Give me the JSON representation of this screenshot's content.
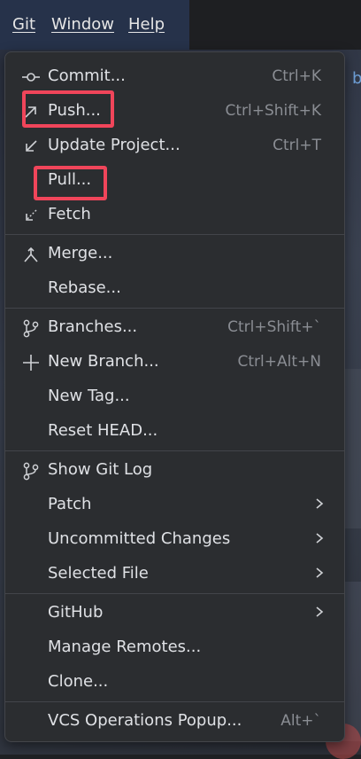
{
  "menubar": {
    "git": "Git",
    "window": "Window",
    "help": "Help"
  },
  "edge_text": "b",
  "menu": {
    "commit": {
      "label": "Commit...",
      "shortcut": "Ctrl+K"
    },
    "push": {
      "label": "Push...",
      "shortcut": "Ctrl+Shift+K"
    },
    "update_project": {
      "label": "Update Project...",
      "shortcut": "Ctrl+T"
    },
    "pull": {
      "label": "Pull..."
    },
    "fetch": {
      "label": "Fetch"
    },
    "merge": {
      "label": "Merge..."
    },
    "rebase": {
      "label": "Rebase..."
    },
    "branches": {
      "label": "Branches...",
      "shortcut": "Ctrl+Shift+`"
    },
    "new_branch": {
      "label": "New Branch...",
      "shortcut": "Ctrl+Alt+N"
    },
    "new_tag": {
      "label": "New Tag..."
    },
    "reset_head": {
      "label": "Reset HEAD..."
    },
    "show_git_log": {
      "label": "Show Git Log"
    },
    "patch": {
      "label": "Patch"
    },
    "uncommitted_changes": {
      "label": "Uncommitted Changes"
    },
    "selected_file": {
      "label": "Selected File"
    },
    "github": {
      "label": "GitHub"
    },
    "manage_remotes": {
      "label": "Manage Remotes..."
    },
    "clone": {
      "label": "Clone..."
    },
    "vcs_popup": {
      "label": "VCS Operations Popup...",
      "shortcut": "Alt+`"
    }
  },
  "highlight_color": "#f0455a",
  "icons": [
    "commit-icon",
    "push-icon",
    "update-icon",
    "fetch-icon",
    "merge-icon",
    "branches-icon",
    "plus-icon",
    "git-log-icon",
    "chevron-right-icon"
  ]
}
